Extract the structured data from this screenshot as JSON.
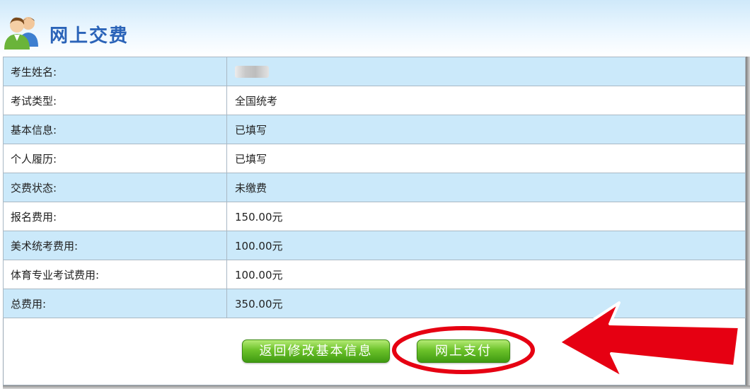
{
  "header": {
    "title": "网上交费",
    "icon": "users-icon"
  },
  "rows": [
    {
      "label": "考生姓名:",
      "value": ""
    },
    {
      "label": "考试类型:",
      "value": "全国统考"
    },
    {
      "label": "基本信息:",
      "value": "已填写"
    },
    {
      "label": "个人履历:",
      "value": "已填写"
    },
    {
      "label": "交费状态:",
      "value": "未缴费"
    },
    {
      "label": "报名费用:",
      "value": "150.00元"
    },
    {
      "label": "美术统考费用:",
      "value": "100.00元"
    },
    {
      "label": "体育专业考试费用:",
      "value": "100.00元"
    },
    {
      "label": "总费用:",
      "value": "350.00元"
    }
  ],
  "buttons": {
    "back": "返回修改基本信息",
    "pay": "网上支付"
  },
  "colors": {
    "row_alt": "#cbe9fa",
    "title": "#2a63b8",
    "button": "#6cc22a",
    "annotation": "#e60012"
  }
}
